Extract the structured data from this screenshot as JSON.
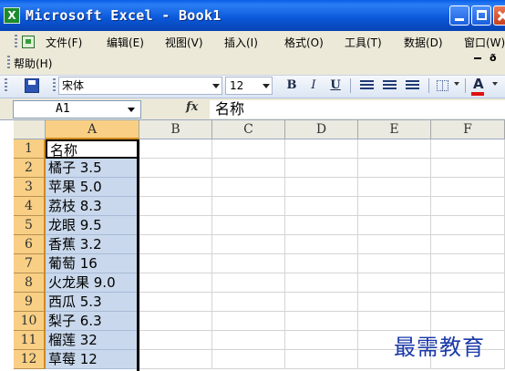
{
  "window": {
    "app_icon_letter": "X",
    "title": "Microsoft Excel - Book1"
  },
  "menu": {
    "items": [
      "文件(F)",
      "编辑(E)",
      "视图(V)",
      "插入(I)",
      "格式(O)",
      "工具(T)",
      "数据(D)",
      "窗口(W)"
    ],
    "help": "帮助(H)",
    "mdi_restore": "ð"
  },
  "toolbar": {
    "font_name": "宋体",
    "font_size": "12",
    "bold": "B",
    "italic": "I",
    "underline": "U",
    "font_color_glyph": "A",
    "font_color": "#e01010"
  },
  "formula_bar": {
    "name_box": "A1",
    "fx": "fx",
    "content": "名称"
  },
  "sheet": {
    "columns": [
      "A",
      "B",
      "C",
      "D",
      "E",
      "F"
    ],
    "rows": [
      {
        "n": "1",
        "a": "名称"
      },
      {
        "n": "2",
        "a": "橘子 3.5"
      },
      {
        "n": "3",
        "a": "苹果 5.0"
      },
      {
        "n": "4",
        "a": "荔枝 8.3"
      },
      {
        "n": "5",
        "a": "龙眼 9.5"
      },
      {
        "n": "6",
        "a": "香蕉 3.2"
      },
      {
        "n": "7",
        "a": "葡萄 16"
      },
      {
        "n": "8",
        "a": "火龙果 9.0"
      },
      {
        "n": "9",
        "a": "西瓜 5.3"
      },
      {
        "n": "10",
        "a": "梨子 6.3"
      },
      {
        "n": "11",
        "a": "榴莲 32"
      },
      {
        "n": "12",
        "a": "草莓 12"
      }
    ]
  },
  "watermark": "最需教育"
}
